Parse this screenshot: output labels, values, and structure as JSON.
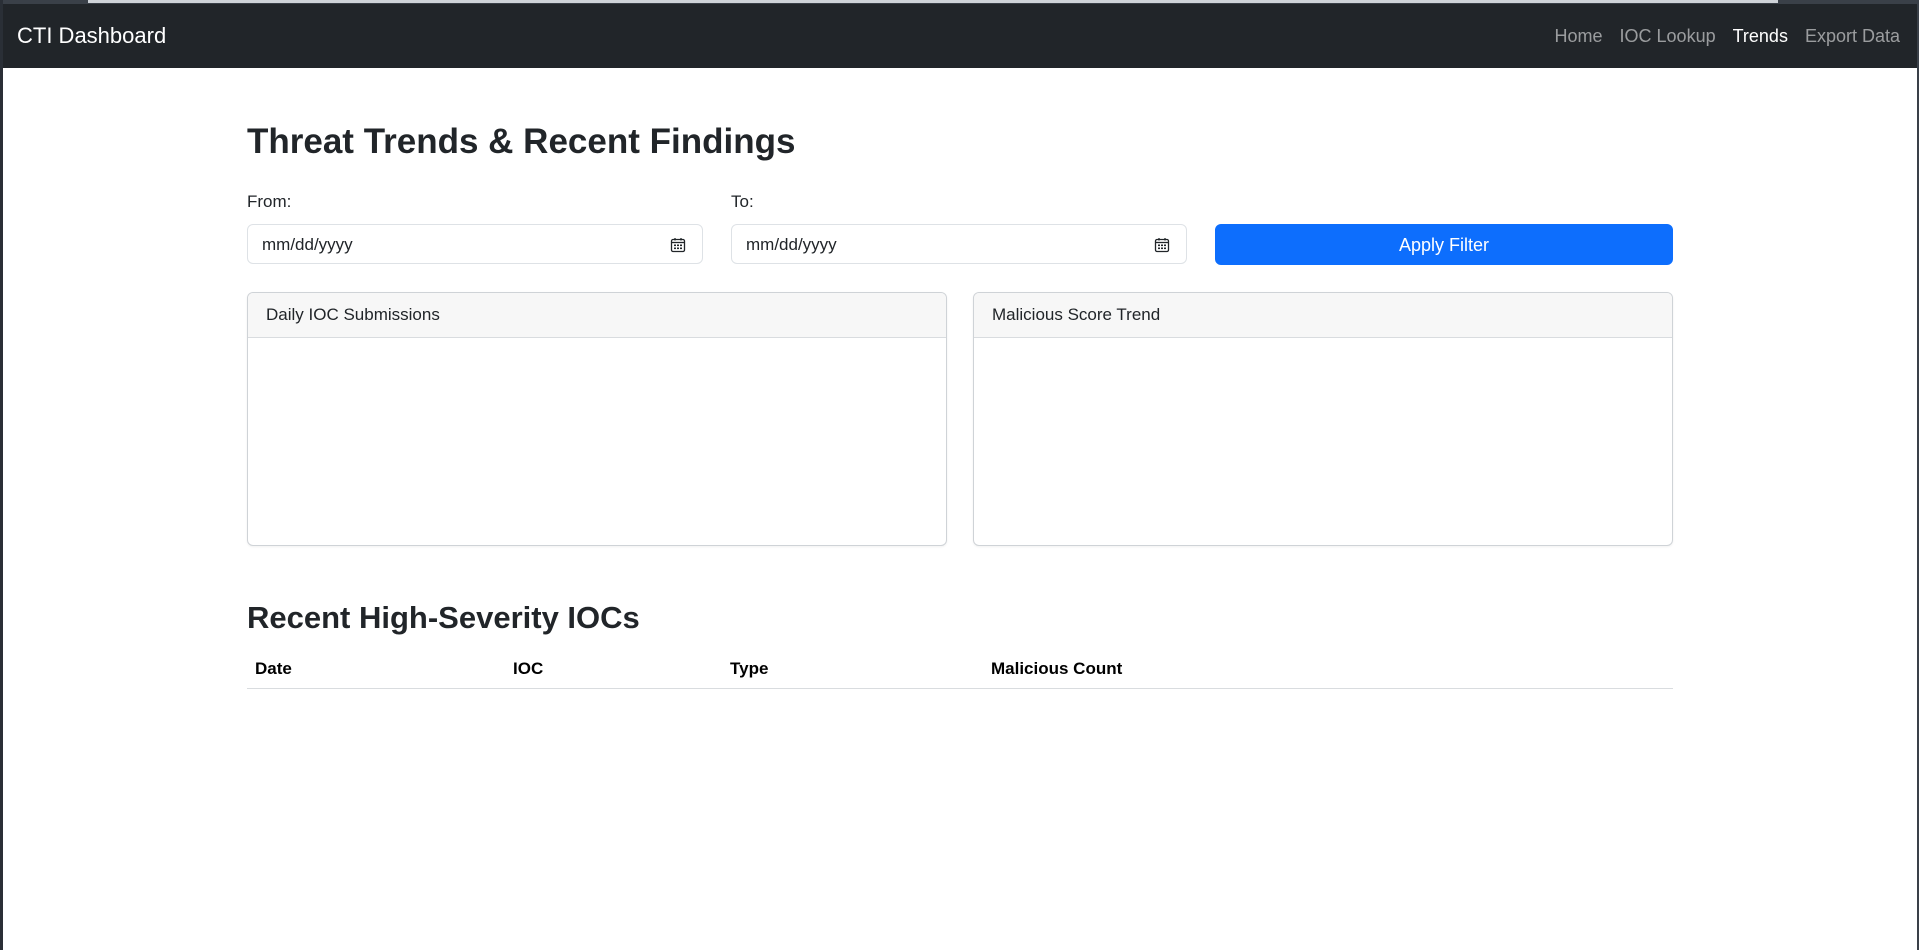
{
  "navbar": {
    "brand": "CTI Dashboard",
    "links": [
      {
        "label": "Home",
        "active": false
      },
      {
        "label": "IOC Lookup",
        "active": false
      },
      {
        "label": "Trends",
        "active": true
      },
      {
        "label": "Export Data",
        "active": false
      }
    ]
  },
  "page": {
    "title": "Threat Trends & Recent Findings"
  },
  "filter": {
    "from_label": "From:",
    "from_value": "mm/dd/yyyy",
    "to_label": "To:",
    "to_value": "mm/dd/yyyy",
    "apply_label": "Apply Filter",
    "accent_color": "#0d6efd"
  },
  "cards": {
    "daily_submissions": {
      "title": "Daily IOC Submissions"
    },
    "malicious_trend": {
      "title": "Malicious Score Trend"
    }
  },
  "recent": {
    "title": "Recent High-Severity IOCs",
    "columns": [
      "Date",
      "IOC",
      "Type",
      "Malicious Count"
    ],
    "rows": []
  },
  "icons": {
    "date_picker": "calendar-icon"
  },
  "colors": {
    "navbar_bg": "#212529",
    "primary": "#0d6efd"
  }
}
